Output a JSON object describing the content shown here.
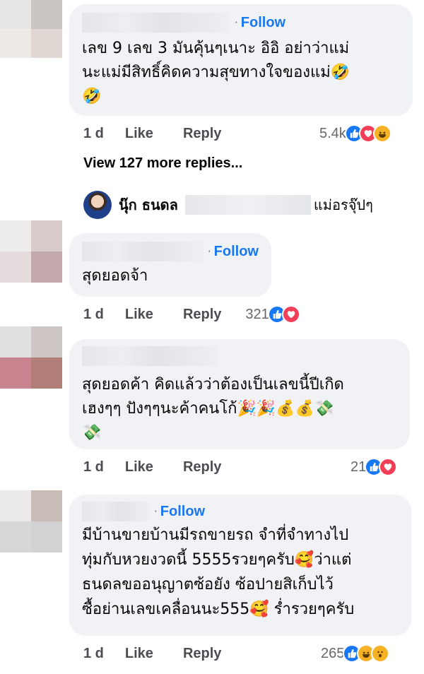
{
  "comments": [
    {
      "follow": "Follow",
      "text": "เลข 9 เลข 3 มันคุ้นๆเนาะ อิอิ อย่าว่าแม่\nนะแม่มีสิทธิ์คิดความสุขทางใจของแม่🤣\n🤣",
      "time": "1 d",
      "like": "Like",
      "reply": "Reply",
      "reaction_count": "5.4k",
      "reactions": [
        "like",
        "love",
        "haha"
      ]
    },
    {
      "follow": "Follow",
      "text": "สุดยอดจ้า",
      "time": "1 d",
      "like": "Like",
      "reply": "Reply",
      "reaction_count": "321",
      "reactions": [
        "like",
        "love"
      ]
    },
    {
      "follow": "",
      "text": "สุดยอดค้า คิดแล้วว่าต้องเป็นเลขนี้ปีเกิด\nเฮงๆๆ ปังๆๆนะค้าคนโก้🎉🎉💰💰💸\n💸",
      "time": "1 d",
      "like": "Like",
      "reply": "Reply",
      "reaction_count": "21",
      "reactions": [
        "like",
        "love"
      ]
    },
    {
      "follow": "Follow",
      "text": "มีบ้านขายบ้านมีรถขายรถ จำที่จำทางไป\nทุ่มกับหวยงวดนี้ 5555รวยๆครับ🥰ว่าแต่\nธนดลขออนุญาตซ้อยัง ซ้อปายสิเก็บไว้\nซื้อย่านเลขเคลื่อนนะ555🥰 ร่ำรวยๆครับ",
      "time": "1 d",
      "like": "Like",
      "reply": "Reply",
      "reaction_count": "265",
      "reactions": [
        "like",
        "haha",
        "haha"
      ]
    }
  ],
  "view_more": "View 127 more replies...",
  "reply_preview": {
    "name": "นุ๊ก ธนดล",
    "snippet": "แม่อรจุ๊ปๆ"
  },
  "colors": {
    "follow": "#1877f2",
    "bubble": "#f0f2f5",
    "like_reaction": "#1877f2",
    "love_reaction": "#f33e58",
    "haha_reaction": "#f7b125"
  }
}
